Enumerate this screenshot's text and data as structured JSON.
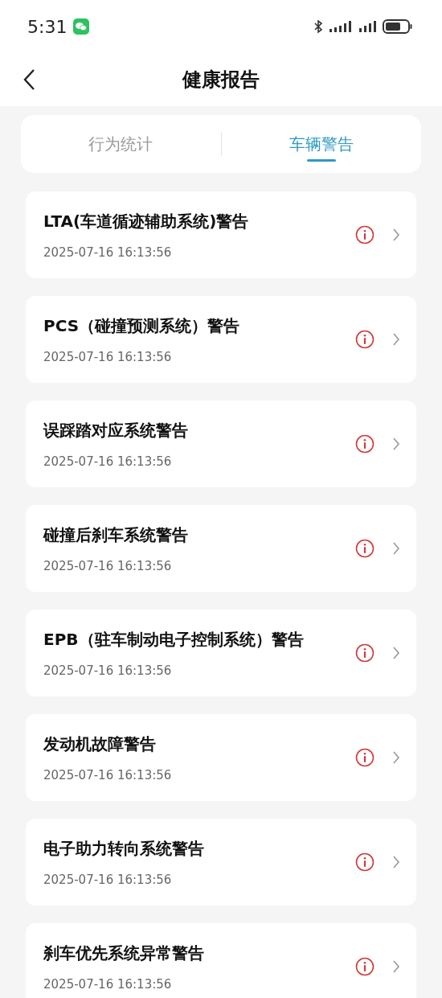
{
  "status_bar": {
    "time": "5:31"
  },
  "header": {
    "title": "健康报告"
  },
  "tabs": [
    {
      "label": "行为统计",
      "selected": false
    },
    {
      "label": "车辆警告",
      "selected": true
    }
  ],
  "warnings": [
    {
      "title": "LTA(车道循迹辅助系统)警告",
      "time": "2025-07-16 16:13:56"
    },
    {
      "title": "PCS（碰撞预测系统）警告",
      "time": "2025-07-16 16:13:56"
    },
    {
      "title": "误踩踏对应系统警告",
      "time": "2025-07-16 16:13:56"
    },
    {
      "title": "碰撞后刹车系统警告",
      "time": "2025-07-16 16:13:56"
    },
    {
      "title": "EPB（驻车制动电子控制系统）警告",
      "time": "2025-07-16 16:13:56"
    },
    {
      "title": "发动机故障警告",
      "time": "2025-07-16 16:13:56"
    },
    {
      "title": "电子助力转向系统警告",
      "time": "2025-07-16 16:13:56"
    },
    {
      "title": "刹车优先系统异常警告",
      "time": "2025-07-16 16:13:56"
    }
  ]
}
